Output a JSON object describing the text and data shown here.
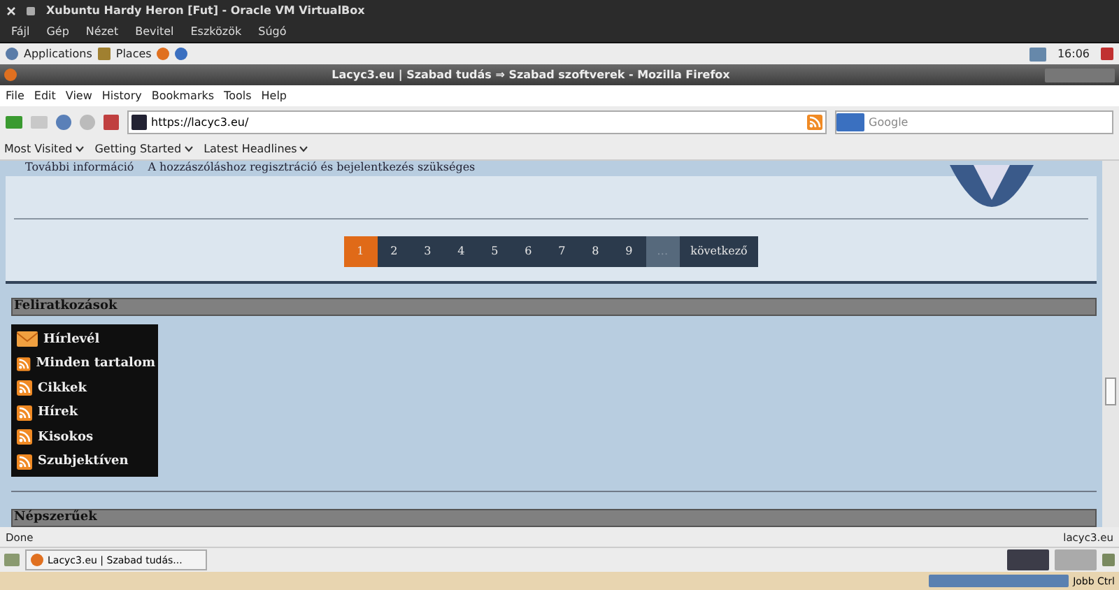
{
  "vm_window": {
    "title": "Xubuntu Hardy Heron [Fut] - Oracle VM VirtualBox",
    "menu": [
      "Fájl",
      "Gép",
      "Nézet",
      "Bevitel",
      "Eszközök",
      "Súgó"
    ]
  },
  "top_panel": {
    "items": [
      "Applications",
      "Places"
    ],
    "clock": "16:06"
  },
  "browser": {
    "title": "Lacyc3.eu | Szabad tudás ⇒ Szabad szoftverek - Mozilla Firefox",
    "menu": [
      "File",
      "Edit",
      "View",
      "History",
      "Bookmarks",
      "Tools",
      "Help"
    ],
    "url": "https://lacyc3.eu/",
    "search_placeholder": "Google",
    "bookmarks": [
      "Most Visited",
      "Getting Started",
      "Latest Headlines"
    ]
  },
  "page": {
    "info_label": "További információ",
    "info_text": "A hozzászóláshoz regisztráció és bejelentkezés szükséges",
    "pager": [
      {
        "label": "1",
        "selected": true,
        "disabled": false
      },
      {
        "label": "2",
        "selected": false,
        "disabled": false
      },
      {
        "label": "3",
        "selected": false,
        "disabled": false
      },
      {
        "label": "4",
        "selected": false,
        "disabled": false
      },
      {
        "label": "5",
        "selected": false,
        "disabled": false
      },
      {
        "label": "6",
        "selected": false,
        "disabled": false
      },
      {
        "label": "7",
        "selected": false,
        "disabled": false
      },
      {
        "label": "8",
        "selected": false,
        "disabled": false
      },
      {
        "label": "9",
        "selected": false,
        "disabled": false
      },
      {
        "label": "…",
        "selected": false,
        "disabled": true
      },
      {
        "label": "következő",
        "selected": false,
        "disabled": false
      }
    ],
    "subscriptions": {
      "heading": "Feliratkozások",
      "items": [
        {
          "label": "Hírlevél",
          "kind": "mail"
        },
        {
          "label": "Minden tartalom",
          "kind": "rss"
        },
        {
          "label": "Cikkek",
          "kind": "rss"
        },
        {
          "label": "Hírek",
          "kind": "rss"
        },
        {
          "label": "Kisokos",
          "kind": "rss"
        },
        {
          "label": "Szubjektíven",
          "kind": "rss"
        }
      ]
    },
    "popular_heading": "Népszerűek"
  },
  "status_bar": {
    "text": "Done",
    "host": "lacyc3.eu"
  },
  "taskbar": {
    "task": "Lacyc3.eu | Szabad tudás..."
  },
  "vm_status": {
    "host_key": "Jobb Ctrl"
  }
}
